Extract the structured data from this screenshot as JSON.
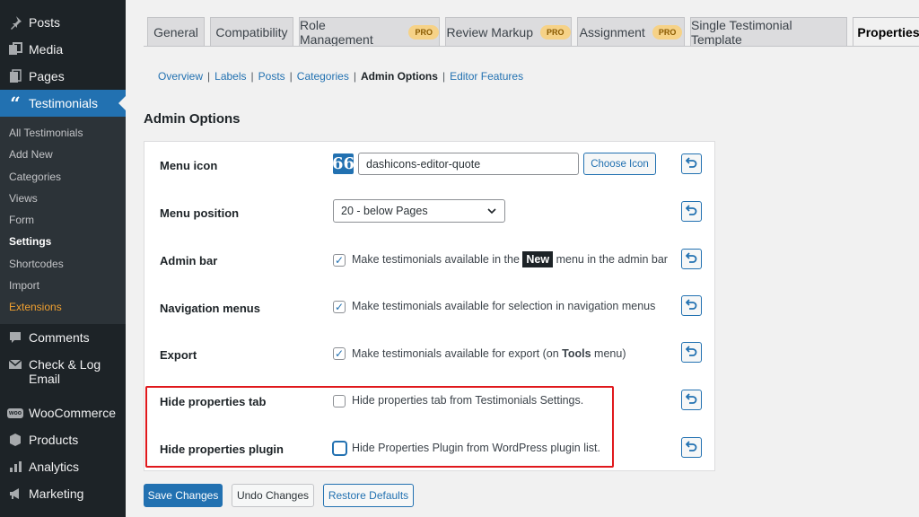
{
  "sidebar": {
    "menu": [
      {
        "label": "Posts",
        "icon": "pin-icon"
      },
      {
        "label": "Media",
        "icon": "media-icon"
      },
      {
        "label": "Pages",
        "icon": "pages-icon"
      },
      {
        "label": "Testimonials",
        "icon": "quote-icon"
      },
      {
        "label": "Comments",
        "icon": "comments-icon"
      },
      {
        "label": "Check & Log Email",
        "icon": "email-icon"
      },
      {
        "label": "WooCommerce",
        "icon": "woo-icon"
      },
      {
        "label": "Products",
        "icon": "products-icon"
      },
      {
        "label": "Analytics",
        "icon": "analytics-icon"
      },
      {
        "label": "Marketing",
        "icon": "marketing-icon"
      }
    ],
    "check_log_line1": "Check & Log",
    "check_log_line2": "Email",
    "woo_icon_text": "woo",
    "submenu": [
      "All Testimonials",
      "Add New",
      "Categories",
      "Views",
      "Form",
      "Settings",
      "Shortcodes",
      "Import",
      "Extensions"
    ]
  },
  "tabs": [
    {
      "label": "General",
      "pro": ""
    },
    {
      "label": "Compatibility",
      "pro": ""
    },
    {
      "label": "Role Management",
      "pro": "PRO"
    },
    {
      "label": "Review Markup",
      "pro": "PRO"
    },
    {
      "label": "Assignment",
      "pro": "PRO"
    },
    {
      "label": "Single Testimonial Template",
      "pro": ""
    },
    {
      "label": "Properties",
      "pro": ""
    }
  ],
  "subnav": [
    "Overview",
    "Labels",
    "Posts",
    "Categories",
    "Admin Options",
    "Editor Features"
  ],
  "section_title": "Admin Options",
  "rows": {
    "menu_icon": {
      "label": "Menu icon",
      "value": "dashicons-editor-quote",
      "button": "Choose Icon",
      "preview_glyph": "66"
    },
    "menu_position": {
      "label": "Menu position",
      "selected": "20 - below Pages"
    },
    "admin_bar": {
      "label": "Admin bar",
      "text_before": "Make testimonials available in the",
      "badge": "New",
      "text_after": "menu in the admin bar",
      "checked": true
    },
    "nav_menus": {
      "label": "Navigation menus",
      "text": "Make testimonials available for selection in navigation menus",
      "checked": true
    },
    "export": {
      "label": "Export",
      "text_before": "Make testimonials available for export (on",
      "bold": "Tools",
      "text_after": "menu)",
      "checked": true
    },
    "hide_tab": {
      "label": "Hide properties tab",
      "text": "Hide properties tab from Testimonials Settings.",
      "checked": false
    },
    "hide_plugin": {
      "label": "Hide properties plugin",
      "text": "Hide Properties Plugin from WordPress plugin list.",
      "checked": false
    }
  },
  "buttons": {
    "save": "Save Changes",
    "undo": "Undo Changes",
    "restore": "Restore Defaults"
  },
  "colors": {
    "accent": "#2271b1",
    "sidebar_bg": "#1d2327",
    "highlight": "#e0181c",
    "pro_badge": "#f6d287"
  }
}
